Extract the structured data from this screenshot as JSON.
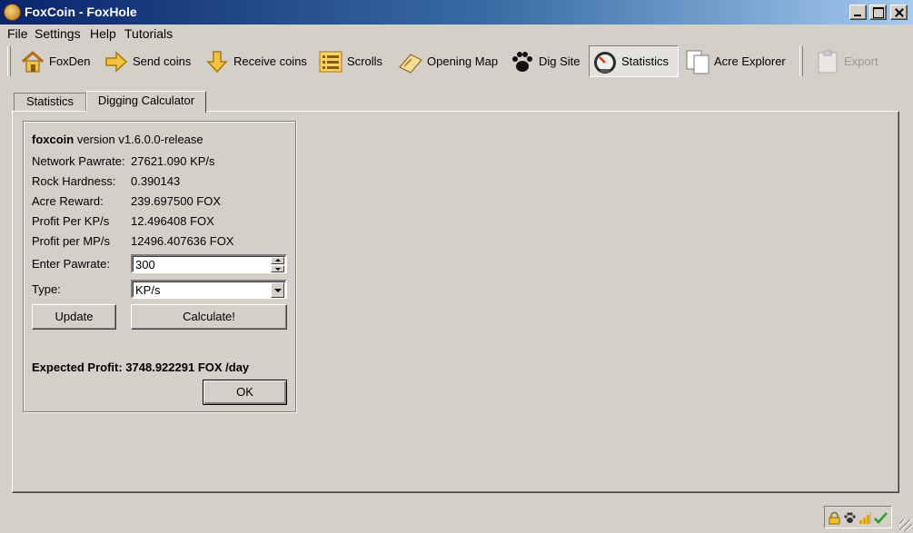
{
  "window": {
    "title": "FoxCoin - FoxHole"
  },
  "menu": {
    "items": [
      "File",
      "Settings",
      "Help",
      "Tutorials"
    ]
  },
  "toolbar": {
    "buttons": [
      {
        "label": "FoxDen",
        "icon": "house-icon"
      },
      {
        "label": "Send coins",
        "icon": "arrow-right-icon"
      },
      {
        "label": "Receive coins",
        "icon": "arrow-down-icon"
      },
      {
        "label": "Scrolls",
        "icon": "list-icon"
      },
      {
        "label": "Opening Map",
        "icon": "map-icon"
      },
      {
        "label": "Dig Site",
        "icon": "paw-icon"
      },
      {
        "label": "Statistics",
        "icon": "speedometer-icon"
      },
      {
        "label": "Acre Explorer",
        "icon": "documents-icon"
      },
      {
        "label": "Export",
        "icon": "clipboard-icon"
      }
    ]
  },
  "tabs": [
    "Statistics",
    "Digging Calculator"
  ],
  "calculator": {
    "app_name": "foxcoin",
    "version_label": "version",
    "version": "v1.6.0.0-release",
    "rows": [
      {
        "label": "Network Pawrate:",
        "value": "27621.090 KP/s"
      },
      {
        "label": "Rock Hardness:",
        "value": "0.390143"
      },
      {
        "label": "Acre Reward:",
        "value": "239.697500 FOX"
      },
      {
        "label": "Profit Per KP/s",
        "value": "12.496408 FOX"
      },
      {
        "label": "Profit per MP/s",
        "value": "12496.407636 FOX"
      }
    ],
    "pawrate_label": "Enter Pawrate:",
    "pawrate_value": "300",
    "type_label": "Type:",
    "type_value": "KP/s",
    "update_label": "Update",
    "calculate_label": "Calculate!",
    "expected_text": "Expected Profit: 3748.922291 FOX /day",
    "ok_label": "OK"
  },
  "colors": {
    "titlebar_start": "#0a246a",
    "titlebar_end": "#a6caf0",
    "face": "#d4d0c8"
  },
  "status_icons": [
    "lock-icon",
    "paw-icon",
    "signal-bars-icon",
    "checkmark-icon"
  ]
}
